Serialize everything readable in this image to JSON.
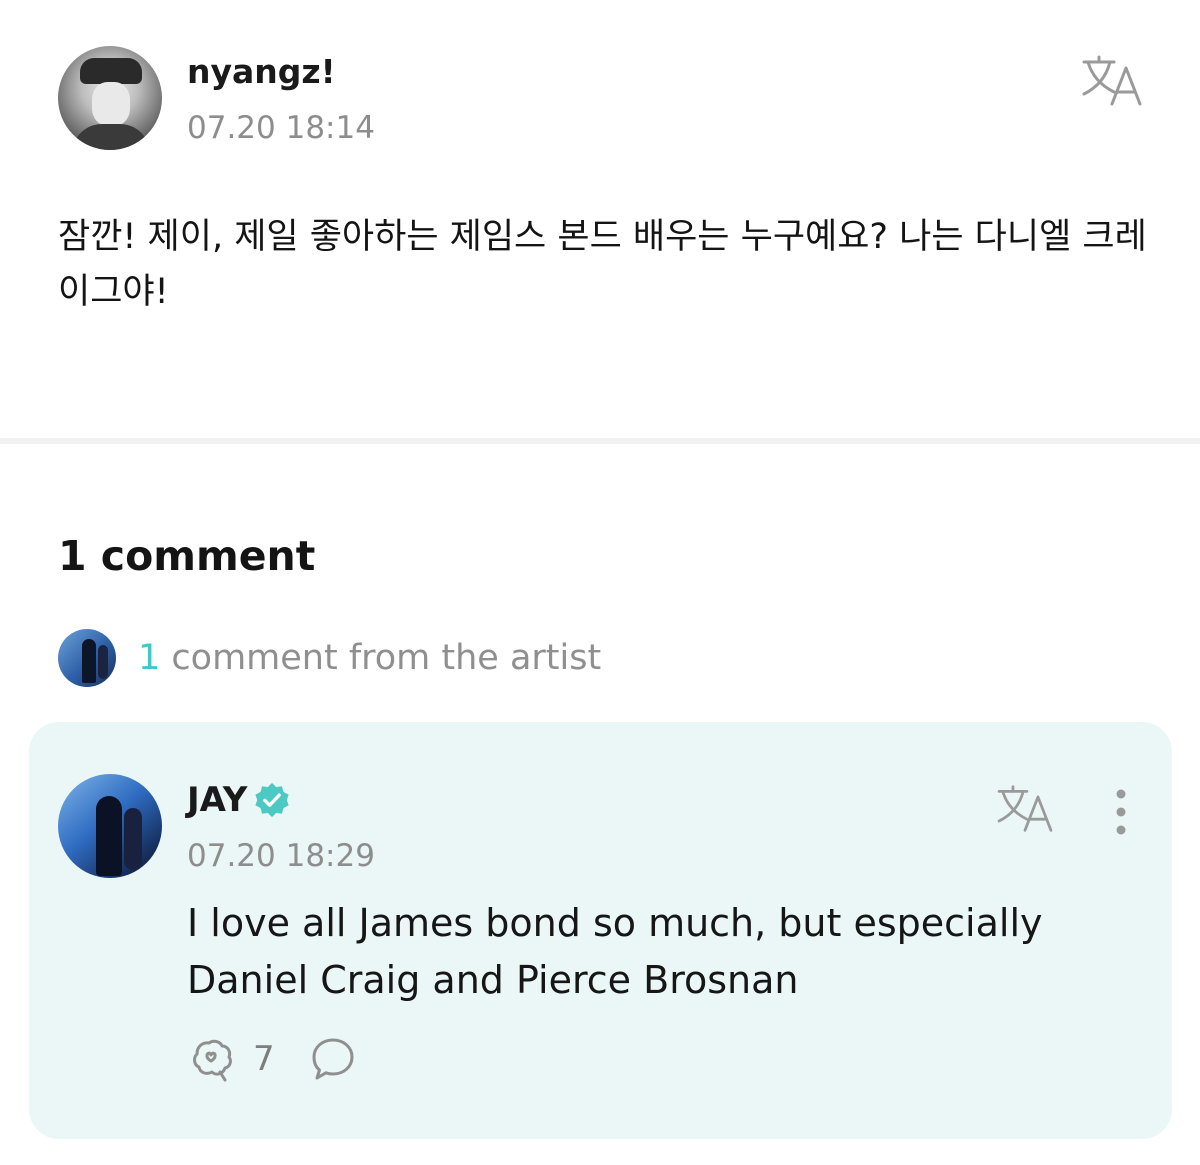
{
  "post": {
    "author": "nyangz!",
    "time": "07.20 18:14",
    "text": "잠깐! 제이, 제일 좋아하는 제임스 본드 배우는 누구예요? 나는 다니엘 크레이그야!",
    "avatar_icon": "user-avatar-photo",
    "translate_icon": "translate-icon"
  },
  "comments": {
    "count_label": "1 comment",
    "artist_count": "1",
    "artist_label": " comment from the artist",
    "items": [
      {
        "author": "JAY",
        "verified_icon": "verified-badge-icon",
        "time": "07.20 18:29",
        "text": "I love all James bond so much, but especially Daniel Craig and Pierce Brosnan",
        "like_count": "7",
        "like_icon": "reaction-icon",
        "reply_icon": "reply-bubble-icon",
        "more_icon": "more-vertical-icon"
      }
    ]
  },
  "colors": {
    "accent": "#3fc9c2",
    "card_background": "#eaf7f6",
    "meta_text": "#8d8d8d"
  }
}
